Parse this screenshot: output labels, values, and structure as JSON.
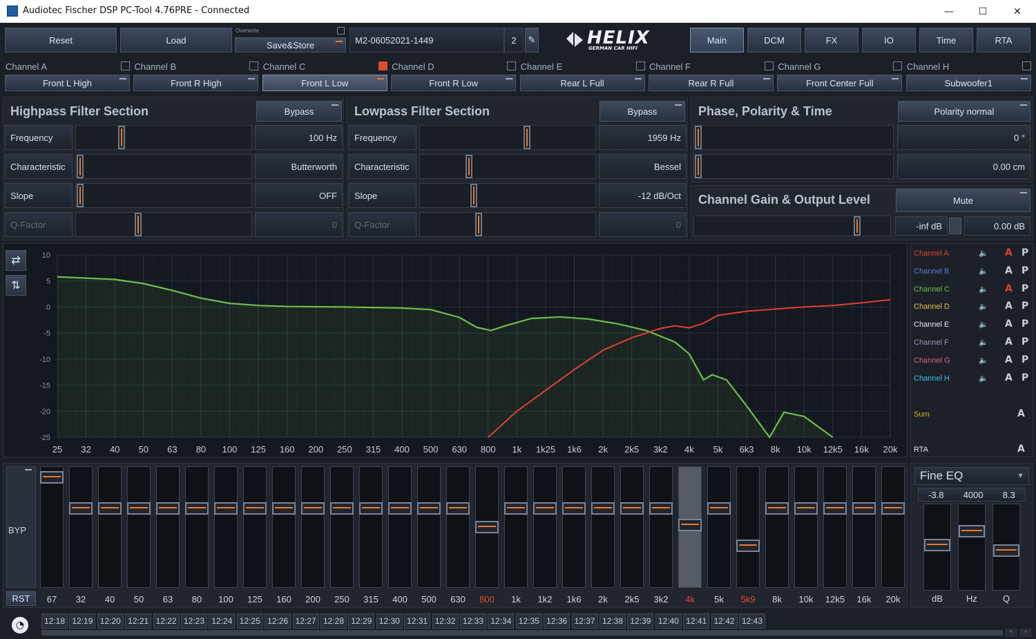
{
  "window": {
    "title": "Audiotec Fischer DSP PC-Tool 4.76PRE - Connected",
    "min": "—",
    "max": "☐",
    "close": "✕"
  },
  "toolbar": {
    "reset": "Reset",
    "load": "Load",
    "overwrite": "Overwrite",
    "savestore": "Save&Store",
    "preset": "M2-06052021-1449",
    "preset_num": "2",
    "logo": "HELIX",
    "logo_sub": "GERMAN CAR HIFI"
  },
  "nav": [
    "Main",
    "DCM",
    "FX",
    "IO",
    "Time",
    "RTA"
  ],
  "channels": [
    {
      "label": "Channel A",
      "name": "Front L High",
      "checked": false
    },
    {
      "label": "Channel B",
      "name": "Front R High",
      "checked": false
    },
    {
      "label": "Channel C",
      "name": "Front L Low",
      "checked": true
    },
    {
      "label": "Channel D",
      "name": "Front R Low",
      "checked": false
    },
    {
      "label": "Channel E",
      "name": "Rear L Full",
      "checked": false
    },
    {
      "label": "Channel F",
      "name": "Rear R Full",
      "checked": false
    },
    {
      "label": "Channel G",
      "name": "Front Center Full",
      "checked": false
    },
    {
      "label": "Channel H",
      "name": "Subwoofer1",
      "checked": false
    }
  ],
  "highpass": {
    "title": "Highpass Filter Section",
    "bypass": "Bypass",
    "rows": [
      {
        "label": "Frequency",
        "value": "100 Hz",
        "pos": 0.25
      },
      {
        "label": "Characteristic",
        "value": "Butterworth",
        "pos": 0.0
      },
      {
        "label": "Slope",
        "value": "OFF",
        "pos": 0.0
      },
      {
        "label": "Q-Factor",
        "value": "0",
        "pos": 0.35
      }
    ]
  },
  "lowpass": {
    "title": "Lowpass Filter Section",
    "bypass": "Bypass",
    "rows": [
      {
        "label": "Frequency",
        "value": "1959 Hz",
        "pos": 0.62
      },
      {
        "label": "Characteristic",
        "value": "Bessel",
        "pos": 0.27
      },
      {
        "label": "Slope",
        "value": "-12 dB/Oct",
        "pos": 0.3
      },
      {
        "label": "Q-Factor",
        "value": "0",
        "pos": 0.33
      }
    ]
  },
  "phase": {
    "title": "Phase, Polarity & Time",
    "polarity": "Polarity normal",
    "phase_value": "0 °",
    "time_value": "0.00 cm"
  },
  "gain": {
    "title": "Channel Gain & Output Level",
    "mute": "Mute",
    "db1": "-inf dB",
    "db2": "0.00 dB",
    "pos": 0.85
  },
  "graph": {
    "y_ticks": [
      "10",
      "5",
      "0",
      "-5",
      "-10",
      "-15",
      "-20",
      "-25"
    ],
    "x_ticks": [
      "25",
      "32",
      "40",
      "50",
      "63",
      "80",
      "100",
      "125",
      "160",
      "200",
      "250",
      "315",
      "400",
      "500",
      "630",
      "800",
      "1k",
      "1k25",
      "1k6",
      "2k",
      "2k5",
      "3k2",
      "4k",
      "5k",
      "6k3",
      "8k",
      "10k",
      "12k5",
      "16k",
      "20k"
    ],
    "colors": {
      "green": "#6cc04a",
      "red": "#e0402e"
    }
  },
  "legend": [
    {
      "name": "Channel A",
      "color": "#e0402e",
      "a_active": true
    },
    {
      "name": "Channel B",
      "color": "#5a78d8",
      "a_active": false
    },
    {
      "name": "Channel C",
      "color": "#6cc04a",
      "a_active": true
    },
    {
      "name": "Channel D",
      "color": "#e0c24a",
      "a_active": false
    },
    {
      "name": "Channel E",
      "color": "#e6e6e6",
      "a_active": false
    },
    {
      "name": "Channel F",
      "color": "#9a8fbf",
      "a_active": false
    },
    {
      "name": "Channel G",
      "color": "#e0607a",
      "a_active": false
    },
    {
      "name": "Channel H",
      "color": "#42b8e8",
      "a_active": false
    }
  ],
  "legend_extra": {
    "sum": "Sum",
    "rta": "RTA",
    "a": "A",
    "p": "P"
  },
  "eq": {
    "byp": "BYP",
    "rst": "RST",
    "bands": [
      {
        "l": "67",
        "v": 0.96,
        "red": false
      },
      {
        "l": "32",
        "v": 0.67,
        "red": false
      },
      {
        "l": "40",
        "v": 0.67,
        "red": false
      },
      {
        "l": "50",
        "v": 0.67,
        "red": false
      },
      {
        "l": "63",
        "v": 0.67,
        "red": false
      },
      {
        "l": "80",
        "v": 0.67,
        "red": false
      },
      {
        "l": "100",
        "v": 0.67,
        "red": false
      },
      {
        "l": "125",
        "v": 0.67,
        "red": false
      },
      {
        "l": "160",
        "v": 0.67,
        "red": false
      },
      {
        "l": "200",
        "v": 0.67,
        "red": false
      },
      {
        "l": "250",
        "v": 0.67,
        "red": false
      },
      {
        "l": "315",
        "v": 0.67,
        "red": false
      },
      {
        "l": "400",
        "v": 0.67,
        "red": false
      },
      {
        "l": "500",
        "v": 0.67,
        "red": false
      },
      {
        "l": "630",
        "v": 0.67,
        "red": false
      },
      {
        "l": "800",
        "v": 0.5,
        "red": true
      },
      {
        "l": "1k",
        "v": 0.67,
        "red": false
      },
      {
        "l": "1k2",
        "v": 0.67,
        "red": false
      },
      {
        "l": "1k6",
        "v": 0.67,
        "red": false
      },
      {
        "l": "2k",
        "v": 0.67,
        "red": false
      },
      {
        "l": "2k5",
        "v": 0.67,
        "red": false
      },
      {
        "l": "3k2",
        "v": 0.67,
        "red": false
      },
      {
        "l": "4k",
        "v": 0.52,
        "red": true
      },
      {
        "l": "5k",
        "v": 0.67,
        "red": false
      },
      {
        "l": "5k9",
        "v": 0.33,
        "red": true
      },
      {
        "l": "8k",
        "v": 0.67,
        "red": false
      },
      {
        "l": "10k",
        "v": 0.67,
        "red": false
      },
      {
        "l": "12k5",
        "v": 0.67,
        "red": false
      },
      {
        "l": "16k",
        "v": 0.67,
        "red": false
      },
      {
        "l": "20k",
        "v": 0.67,
        "red": false
      }
    ]
  },
  "fine": {
    "title": "Fine EQ",
    "values": [
      "-3.8",
      "4000",
      "8.3"
    ],
    "labels": [
      "dB",
      "Hz",
      "Q"
    ]
  },
  "timeline": [
    "12:18",
    "12:19",
    "12:20",
    "12:21",
    "12:22",
    "12:23",
    "12:24",
    "12:25",
    "12:26",
    "12:27",
    "12:28",
    "12:29",
    "12:30",
    "12:31",
    "12:32",
    "12:33",
    "12:34",
    "12:35",
    "12:36",
    "12:37",
    "12:38",
    "12:39",
    "12:40",
    "12:41",
    "12:42",
    "12:43"
  ]
}
